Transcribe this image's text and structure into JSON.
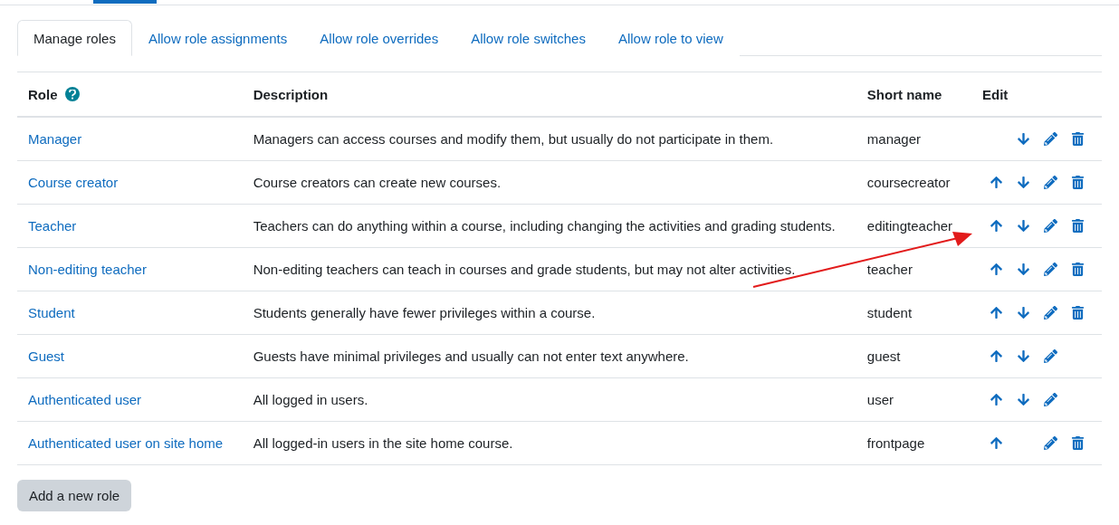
{
  "tabs": [
    {
      "label": "Manage roles",
      "selected": true
    },
    {
      "label": "Allow role assignments",
      "selected": false
    },
    {
      "label": "Allow role overrides",
      "selected": false
    },
    {
      "label": "Allow role switches",
      "selected": false
    },
    {
      "label": "Allow role to view",
      "selected": false
    }
  ],
  "table": {
    "columns": [
      "Role",
      "Description",
      "Short name",
      "Edit"
    ],
    "rows": [
      {
        "role": "Manager",
        "description": "Managers can access courses and modify them, but usually do not participate in them.",
        "short_name": "manager",
        "move_up": false,
        "move_down": true,
        "editable": true,
        "deletable": true
      },
      {
        "role": "Course creator",
        "description": "Course creators can create new courses.",
        "short_name": "coursecreator",
        "move_up": true,
        "move_down": true,
        "editable": true,
        "deletable": true
      },
      {
        "role": "Teacher",
        "description": "Teachers can do anything within a course, including changing the activities and grading students.",
        "short_name": "editingteacher",
        "move_up": true,
        "move_down": true,
        "editable": true,
        "deletable": true
      },
      {
        "role": "Non-editing teacher",
        "description": "Non-editing teachers can teach in courses and grade students, but may not alter activities.",
        "short_name": "teacher",
        "move_up": true,
        "move_down": true,
        "editable": true,
        "deletable": true
      },
      {
        "role": "Student",
        "description": "Students generally have fewer privileges within a course.",
        "short_name": "student",
        "move_up": true,
        "move_down": true,
        "editable": true,
        "deletable": true
      },
      {
        "role": "Guest",
        "description": "Guests have minimal privileges and usually can not enter text anywhere.",
        "short_name": "guest",
        "move_up": true,
        "move_down": true,
        "editable": true,
        "deletable": false
      },
      {
        "role": "Authenticated user",
        "description": "All logged in users.",
        "short_name": "user",
        "move_up": true,
        "move_down": true,
        "editable": true,
        "deletable": false
      },
      {
        "role": "Authenticated user on site home",
        "description": "All logged-in users in the site home course.",
        "short_name": "frontpage",
        "move_up": true,
        "move_down": false,
        "editable": true,
        "deletable": true
      }
    ]
  },
  "add_button": "Add a new role"
}
